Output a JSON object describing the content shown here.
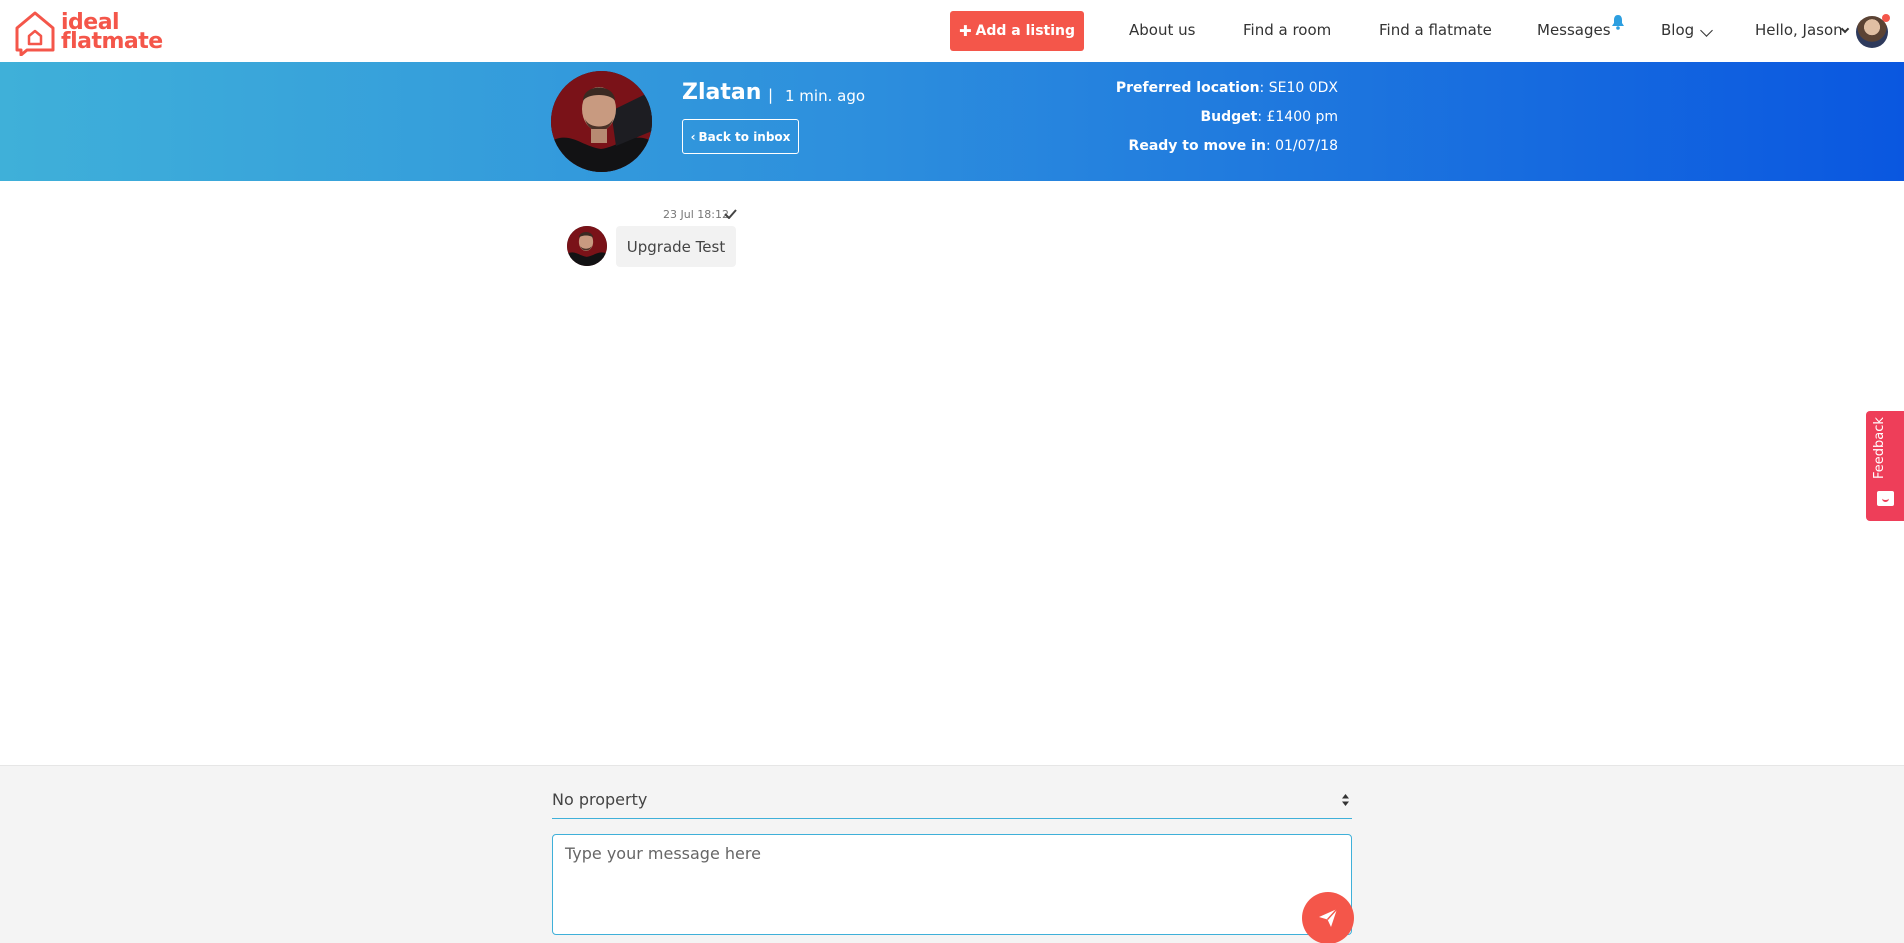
{
  "brand": {
    "line1": "ideal",
    "line2": "flatmate",
    "color": "#f4564a"
  },
  "nav": {
    "add_listing": "Add a listing",
    "about": "About us",
    "find_room": "Find a room",
    "find_flatmate": "Find a flatmate",
    "messages": "Messages",
    "blog": "Blog",
    "greeting": "Hello, Jason"
  },
  "conversation": {
    "name": "Zlatan",
    "separator": "|",
    "last_seen": "1 min. ago",
    "back_label": "Back to inbox",
    "preferred_location_label": "Preferred location",
    "preferred_location": ": SE10 0DX",
    "budget_label": "Budget",
    "budget": ": £1400 pm",
    "move_in_label": "Ready to move in",
    "move_in": ": 01/07/18"
  },
  "messages": [
    {
      "timestamp": "23 Jul 18:12",
      "text": "Upgrade Test",
      "read": true
    }
  ],
  "composer": {
    "property_select": "No property",
    "placeholder": "Type your message here"
  },
  "feedback": {
    "label": "Feedback",
    "color": "#ee3e59"
  },
  "icons": [
    "house-logo-icon",
    "plus-icon",
    "bell-icon",
    "chevron-down-icon",
    "check-icon",
    "sort-arrows-icon",
    "send-icon",
    "feedback-icon"
  ]
}
